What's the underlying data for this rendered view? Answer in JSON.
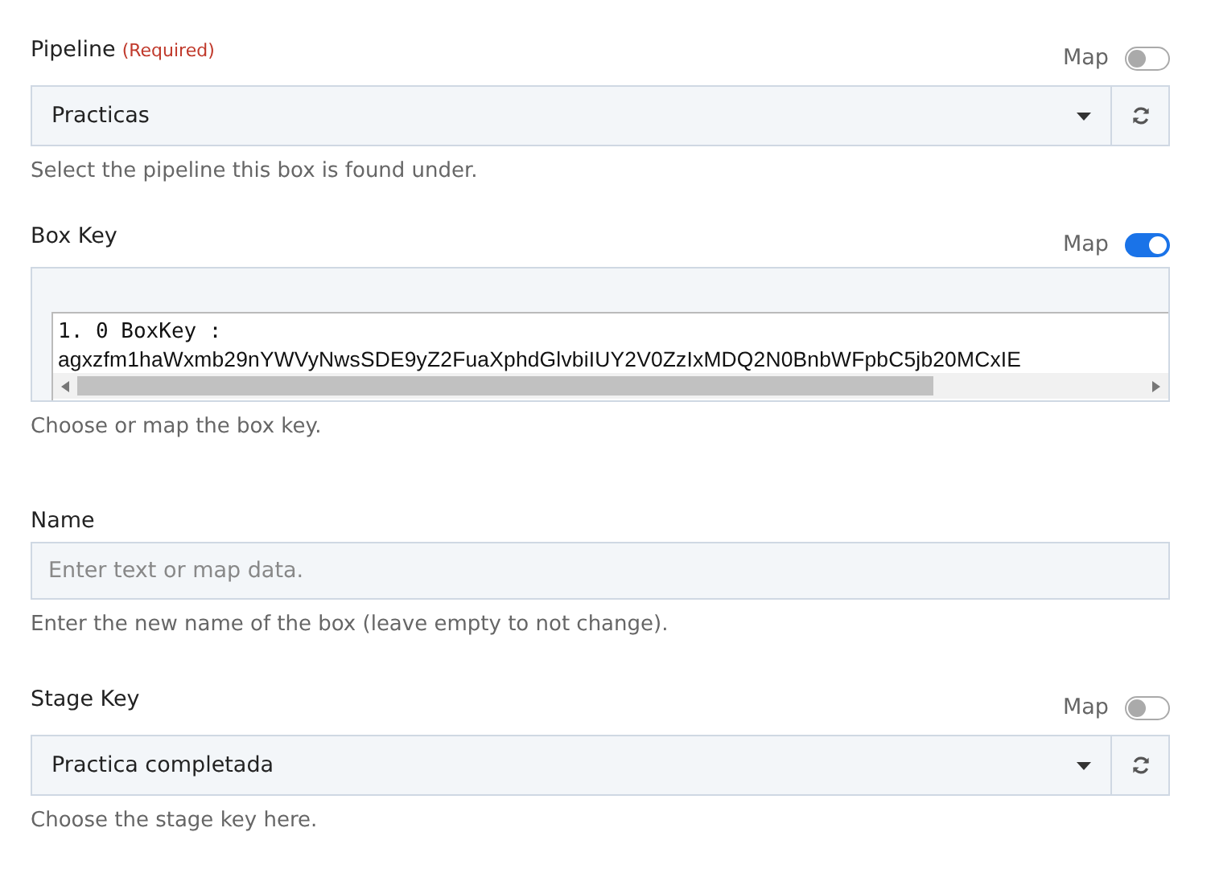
{
  "fields": [
    {
      "kind": "select",
      "label": "Pipeline",
      "required": "(Required)",
      "map_label": "Map",
      "map_on": false,
      "value": "Practicas",
      "help": "Select the pipeline this box is found under."
    },
    {
      "kind": "mapped",
      "label": "Box Key",
      "map_label": "Map",
      "map_on": true,
      "lines": [
        "1. 0 BoxKey :",
        "agxzfm1haWxmb29nYWVyNwsSDE9yZ2FuaXphdGlvbiIUY2V0ZzIxMDQ2N0BnbWFpbC5jb20MCxIE"
      ],
      "help": "Choose or map the box key."
    },
    {
      "kind": "text",
      "label": "Name",
      "placeholder": "Enter text or map data.",
      "help": "Enter the new name of the box (leave empty to not change)."
    },
    {
      "kind": "select",
      "label": "Stage Key",
      "map_label": "Map",
      "map_on": false,
      "value": "Practica completada",
      "help": "Choose the stage key here."
    }
  ]
}
